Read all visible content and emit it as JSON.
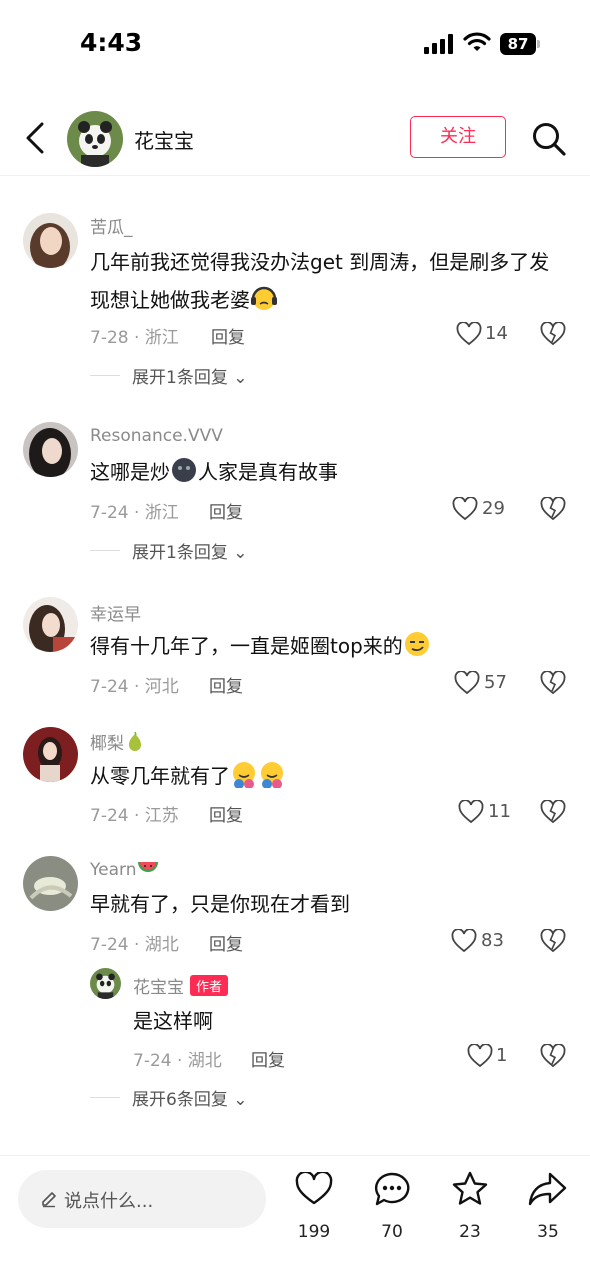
{
  "status": {
    "time": "4:43",
    "battery": "87"
  },
  "header": {
    "name": "花宝宝",
    "follow_label": "关注"
  },
  "comments": [
    {
      "user": "苦瓜_",
      "text": "几年前我还觉得我没办法get 到周涛，但是刷多了发现想让她做我老婆",
      "meta": "7-28 · 浙江",
      "reply": "回复",
      "likes": "14",
      "expand": "展开1条回复"
    },
    {
      "user": "Resonance.VVV",
      "text_a": "这哪是炒",
      "text_b": "人家是真有故事",
      "meta": "7-24 · 浙江",
      "reply": "回复",
      "likes": "29",
      "expand": "展开1条回复"
    },
    {
      "user": "幸运早",
      "text": "得有十几年了，一直是姬圈top来的",
      "meta": "7-24 · 河北",
      "reply": "回复",
      "likes": "57"
    },
    {
      "user": "椰梨",
      "text": "从零几年就有了",
      "meta": "7-24 · 江苏",
      "reply": "回复",
      "likes": "11"
    },
    {
      "user": "Yearn",
      "text": "早就有了，只是你现在才看到",
      "meta": "7-24 · 湖北",
      "reply": "回复",
      "likes": "83",
      "expand": "展开6条回复"
    }
  ],
  "sub_reply": {
    "user": "花宝宝",
    "badge": "作者",
    "text": "是这样啊",
    "meta": "7-24 · 湖北",
    "reply": "回复",
    "likes": "1"
  },
  "bottom": {
    "placeholder": "说点什么...",
    "likes": "199",
    "comments": "70",
    "favorites": "23",
    "shares": "35"
  },
  "colors": {
    "accent": "#fe2c55",
    "meta": "#9a9a9a"
  }
}
